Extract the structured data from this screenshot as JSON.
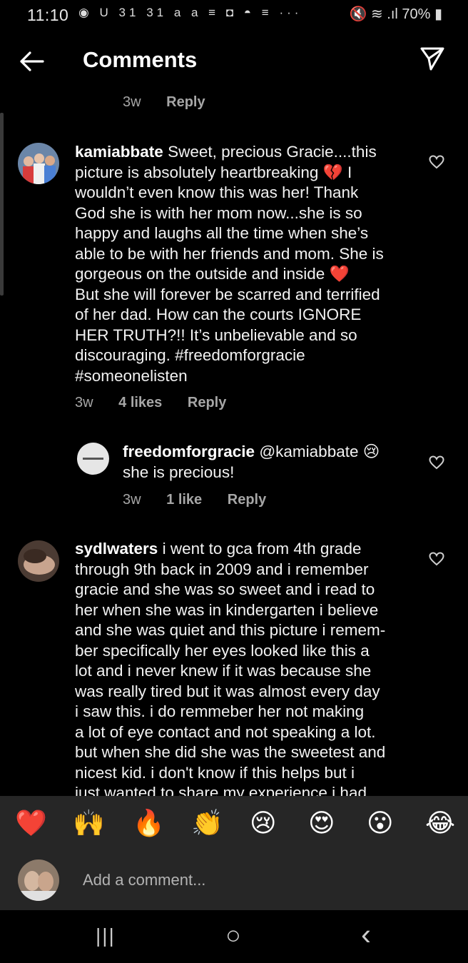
{
  "status_bar": {
    "time": "11:10",
    "left_icons": "◉ U 31 31 a a ≡ ◘ ◓ ≡ ···",
    "right_icons": "🔇 ≋ .ıl",
    "battery": "70%"
  },
  "header": {
    "title": "Comments",
    "back_icon": "arrow-left-icon",
    "send_icon": "paper-plane-icon"
  },
  "top_meta": {
    "time": "3w",
    "reply": "Reply"
  },
  "comments": [
    {
      "username": "kamiabbate",
      "lines": [
        "Sweet, precious Gracie....this",
        "picture is absolutely heartbreaking 💔 I",
        "wouldn’t  even know this was her!  Thank",
        "God she is with her mom now...she is so",
        "happy and laughs all the time when she’s",
        "able to be with her friends and mom.  She is",
        "gorgeous on the outside and inside ❤️",
        "But she will forever be scarred and terrified",
        "of her dad.  How can the courts IGNORE",
        "HER TRUTH?!! It’s unbelievable and so",
        "discouraging.  #freedomforgracie",
        "#someonelisten"
      ],
      "time": "3w",
      "likes": "4 likes",
      "reply": "Reply"
    },
    {
      "username": "freedomforgracie",
      "lines": [
        "@kamiabbate 😢",
        "she is precious!"
      ],
      "time": "3w",
      "likes": "1 like",
      "reply": "Reply"
    },
    {
      "username": "sydlwaters",
      "lines": [
        "i went to gca from 4th grade",
        "through 9th back in 2009 and i remember",
        "gracie and she was so sweet and i read to",
        "her when she was in kindergarten i believe",
        "and she was quiet and this picture i remem-",
        "ber specifically her eyes looked like this a",
        "lot and i never knew if it was because she",
        "was really tired but it was almost every day",
        "i saw this. i do remmeber her not making",
        "a lot of eye contact and not speaking a lot.",
        "but when she did she was the sweetest and",
        "nicest kid. i don't know if this helps but i",
        "just wanted to share my experience i had"
      ]
    }
  ],
  "reactions": [
    "❤️",
    "🙌",
    "🔥",
    "👏",
    "😢",
    "😍",
    "😮",
    "😂"
  ],
  "composer": {
    "placeholder": "Add a comment..."
  },
  "nav": {
    "recents": "|||",
    "home": "○",
    "back": "‹"
  }
}
